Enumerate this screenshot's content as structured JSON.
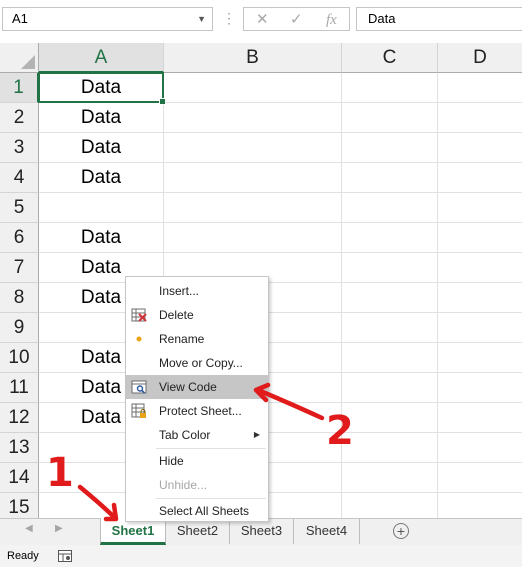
{
  "formula_bar": {
    "name_box": "A1",
    "cancel_symbol": "✕",
    "enter_symbol": "✓",
    "fx_symbol": "fx",
    "formula": "Data"
  },
  "columns": [
    "A",
    "B",
    "C",
    "D"
  ],
  "rows": [
    {
      "num": "1",
      "a": "Data"
    },
    {
      "num": "2",
      "a": "Data"
    },
    {
      "num": "3",
      "a": "Data"
    },
    {
      "num": "4",
      "a": "Data"
    },
    {
      "num": "5",
      "a": ""
    },
    {
      "num": "6",
      "a": "Data"
    },
    {
      "num": "7",
      "a": "Data"
    },
    {
      "num": "8",
      "a": "Data"
    },
    {
      "num": "9",
      "a": ""
    },
    {
      "num": "10",
      "a": "Data"
    },
    {
      "num": "11",
      "a": "Data"
    },
    {
      "num": "12",
      "a": "Data"
    },
    {
      "num": "13",
      "a": ""
    },
    {
      "num": "14",
      "a": ""
    },
    {
      "num": "15",
      "a": ""
    }
  ],
  "context_menu": {
    "items": [
      {
        "label": "Insert...",
        "icon": ""
      },
      {
        "label": "Delete",
        "icon": "delete-sheet-icon"
      },
      {
        "label": "Rename",
        "icon": "rename-dot-icon"
      },
      {
        "label": "Move or Copy...",
        "icon": ""
      },
      {
        "label": "View Code",
        "icon": "view-code-icon"
      },
      {
        "label": "Protect Sheet...",
        "icon": "protect-sheet-icon"
      },
      {
        "label": "Tab Color",
        "icon": "",
        "submenu_arrow": "▶"
      },
      {
        "label": "Hide",
        "icon": ""
      },
      {
        "label": "Unhide...",
        "icon": ""
      },
      {
        "label": "Select All Sheets",
        "icon": ""
      }
    ]
  },
  "sheet_tabs": [
    "Sheet1",
    "Sheet2",
    "Sheet3",
    "Sheet4"
  ],
  "active_sheet": "Sheet1",
  "tab_nav": {
    "prev": "◀",
    "next": "▶",
    "add": "+"
  },
  "status_bar": {
    "text": "Ready"
  },
  "annotations": {
    "label_1": "1",
    "label_2": "2",
    "color": "#e11b1b"
  },
  "colors": {
    "accent": "#217346",
    "menu_highlight": "#c6c6c6"
  }
}
